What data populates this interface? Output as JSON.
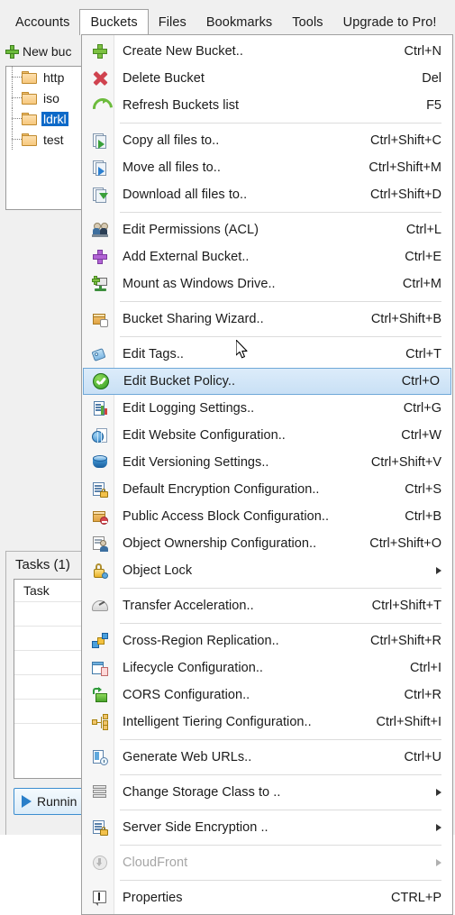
{
  "app": {
    "menubar": [
      {
        "label": "Accounts",
        "open": false
      },
      {
        "label": "Buckets",
        "open": true
      },
      {
        "label": "Files",
        "open": false
      },
      {
        "label": "Bookmarks",
        "open": false
      },
      {
        "label": "Tools",
        "open": false
      },
      {
        "label": "Upgrade to Pro!",
        "open": false
      }
    ]
  },
  "sidebar": {
    "new_bucket_label": "New buc",
    "buckets": [
      {
        "name": "http",
        "selected": false
      },
      {
        "name": "iso",
        "selected": false
      },
      {
        "name": "ldrkl",
        "selected": true
      },
      {
        "name": "test",
        "selected": false
      }
    ],
    "tasks": {
      "title": "Tasks (1)",
      "column_header": "Task",
      "running_label": "Runnin"
    }
  },
  "menu": {
    "title": "Buckets",
    "items": [
      {
        "type": "item",
        "icon": "plus-green-icon",
        "label": "Create New Bucket..",
        "accel": "Ctrl+N"
      },
      {
        "type": "item",
        "icon": "delete-x-icon",
        "label": "Delete Bucket",
        "accel": "Del"
      },
      {
        "type": "item",
        "icon": "refresh-icon",
        "label": "Refresh Buckets list",
        "accel": "F5"
      },
      {
        "type": "separator"
      },
      {
        "type": "item",
        "icon": "copy-files-icon",
        "label": "Copy all files to..",
        "accel": "Ctrl+Shift+C"
      },
      {
        "type": "item",
        "icon": "move-files-icon",
        "label": "Move all files to..",
        "accel": "Ctrl+Shift+M"
      },
      {
        "type": "item",
        "icon": "download-files-icon",
        "label": "Download all files to..",
        "accel": "Ctrl+Shift+D"
      },
      {
        "type": "separator"
      },
      {
        "type": "item",
        "icon": "users-acl-icon",
        "label": "Edit Permissions (ACL)",
        "accel": "Ctrl+L"
      },
      {
        "type": "item",
        "icon": "plus-purple-icon",
        "label": "Add External Bucket..",
        "accel": "Ctrl+E"
      },
      {
        "type": "item",
        "icon": "mount-drive-icon",
        "label": "Mount as Windows Drive..",
        "accel": "Ctrl+M"
      },
      {
        "type": "separator"
      },
      {
        "type": "item",
        "icon": "sharing-wizard-icon",
        "label": "Bucket Sharing Wizard..",
        "accel": "Ctrl+Shift+B"
      },
      {
        "type": "separator"
      },
      {
        "type": "item",
        "icon": "tag-icon",
        "label": "Edit Tags..",
        "accel": "Ctrl+T"
      },
      {
        "type": "item",
        "icon": "bucket-policy-icon",
        "label": "Edit Bucket Policy..",
        "accel": "Ctrl+O",
        "highlighted": true
      },
      {
        "type": "item",
        "icon": "logging-icon",
        "label": "Edit Logging Settings..",
        "accel": "Ctrl+G"
      },
      {
        "type": "item",
        "icon": "website-config-icon",
        "label": "Edit Website Configuration..",
        "accel": "Ctrl+W"
      },
      {
        "type": "item",
        "icon": "versioning-icon",
        "label": "Edit Versioning Settings..",
        "accel": "Ctrl+Shift+V"
      },
      {
        "type": "item",
        "icon": "encryption-icon",
        "label": "Default Encryption Configuration..",
        "accel": "Ctrl+S"
      },
      {
        "type": "item",
        "icon": "public-access-block-icon",
        "label": "Public Access Block Configuration..",
        "accel": "Ctrl+B"
      },
      {
        "type": "item",
        "icon": "object-ownership-icon",
        "label": "Object Ownership Configuration..",
        "accel": "Ctrl+Shift+O"
      },
      {
        "type": "item",
        "icon": "object-lock-icon",
        "label": "Object Lock",
        "accel": "",
        "submenu": true
      },
      {
        "type": "separator"
      },
      {
        "type": "item",
        "icon": "transfer-acceleration-icon",
        "label": "Transfer Acceleration..",
        "accel": "Ctrl+Shift+T"
      },
      {
        "type": "separator"
      },
      {
        "type": "item",
        "icon": "cross-region-replication-icon",
        "label": "Cross-Region Replication..",
        "accel": "Ctrl+Shift+R"
      },
      {
        "type": "item",
        "icon": "lifecycle-icon",
        "label": "Lifecycle Configuration..",
        "accel": "Ctrl+I"
      },
      {
        "type": "item",
        "icon": "cors-icon",
        "label": "CORS Configuration..",
        "accel": "Ctrl+R"
      },
      {
        "type": "item",
        "icon": "intelligent-tiering-icon",
        "label": "Intelligent Tiering Configuration..",
        "accel": "Ctrl+Shift+I"
      },
      {
        "type": "separator"
      },
      {
        "type": "item",
        "icon": "generate-web-urls-icon",
        "label": "Generate Web URLs..",
        "accel": "Ctrl+U"
      },
      {
        "type": "separator"
      },
      {
        "type": "item",
        "icon": "storage-class-icon",
        "label": "Change Storage Class to ..",
        "accel": "",
        "submenu": true
      },
      {
        "type": "separator"
      },
      {
        "type": "item",
        "icon": "server-side-encryption-icon",
        "label": "Server Side Encryption ..",
        "accel": "",
        "submenu": true
      },
      {
        "type": "separator"
      },
      {
        "type": "item",
        "icon": "cloudfront-icon",
        "label": "CloudFront",
        "accel": "",
        "submenu": true,
        "disabled": true
      },
      {
        "type": "separator"
      },
      {
        "type": "item",
        "icon": "properties-info-icon",
        "label": "Properties",
        "accel": "CTRL+P"
      }
    ]
  },
  "colors": {
    "highlight": "#c9e0f5",
    "highlight_border": "#6fa8d8",
    "selection_blue": "#0d69c8",
    "menu_bg": "#ffffff",
    "gutter_bg": "#f6f6f6",
    "window_bg": "#f0f0f0"
  }
}
